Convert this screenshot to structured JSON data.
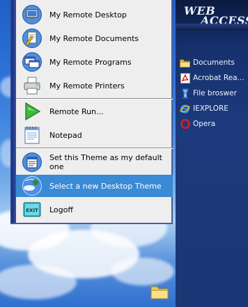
{
  "menu": {
    "items": [
      {
        "label": "My Remote Desktop",
        "icon": "monitor-icon"
      },
      {
        "label": "My Remote Documents",
        "icon": "documents-icon"
      },
      {
        "label": "My Remote Programs",
        "icon": "programs-icon"
      },
      {
        "label": "My Remote Printers",
        "icon": "printer-icon"
      },
      {
        "label": "Remote Run...",
        "icon": "run-arrow-icon"
      },
      {
        "label": "Notepad",
        "icon": "notepad-icon"
      },
      {
        "label": "Set this Theme as my default one",
        "icon": "theme-default-icon"
      },
      {
        "label": "Select a new Desktop Theme",
        "icon": "theme-select-icon"
      },
      {
        "label": "Logoff",
        "icon": "exit-icon"
      }
    ],
    "selected_index": 7,
    "exit_icon_text": "EXIT"
  },
  "logo": {
    "line1": "WEB",
    "line2": "ACCESS"
  },
  "sidebar": {
    "items": [
      {
        "label": "Documents",
        "icon": "folder-icon"
      },
      {
        "label": "Acrobat Rea...",
        "icon": "acrobat-icon"
      },
      {
        "label": "File broswer",
        "icon": "file-browser-icon"
      },
      {
        "label": "IEXPLORE",
        "icon": "ie-icon"
      },
      {
        "label": "Opera",
        "icon": "opera-icon"
      }
    ]
  },
  "colors": {
    "selection": "#3a8ad6",
    "sidebar_bg": "#1c3a7c",
    "menu_bg": "#eeeeee"
  }
}
